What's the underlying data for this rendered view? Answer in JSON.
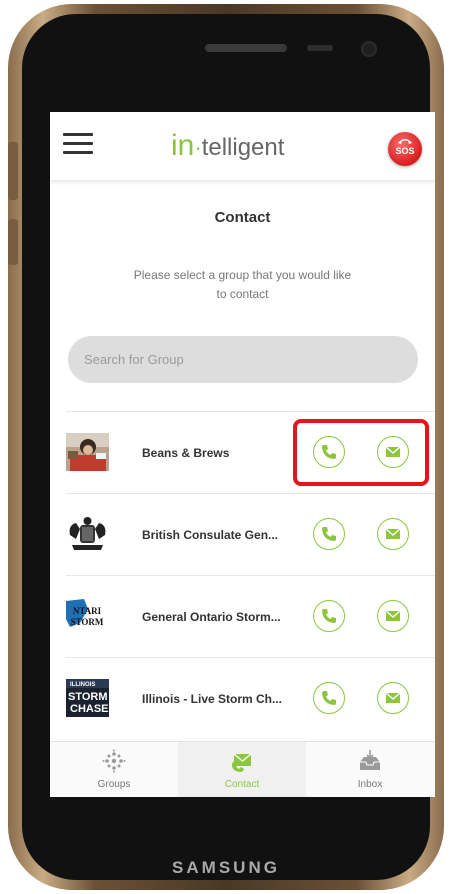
{
  "device": {
    "brand": "SAMSUNG"
  },
  "header": {
    "logo_in": "in",
    "logo_dot": "·",
    "logo_rest": "telligent",
    "sos_label": "SOS"
  },
  "page": {
    "title": "Contact",
    "subtitle": "Please select a group that you would like to contact"
  },
  "search": {
    "placeholder": "Search for Group",
    "value": ""
  },
  "groups": [
    {
      "name": "Beans & Brews"
    },
    {
      "name": "British Consulate Gen..."
    },
    {
      "name": "General Ontario Storm..."
    },
    {
      "name": "Illinois - Live Storm Ch..."
    }
  ],
  "avatar_text": {
    "ontario": "NTARI STORM",
    "illinois": "ILLINOIS STORM CHASE"
  },
  "nav": {
    "items": [
      {
        "label": "Groups"
      },
      {
        "label": "Contact"
      },
      {
        "label": "Inbox"
      }
    ],
    "active": "Contact"
  },
  "colors": {
    "accent": "#8cc63f",
    "sos": "#d61f1f",
    "highlight": "#e8141b"
  }
}
